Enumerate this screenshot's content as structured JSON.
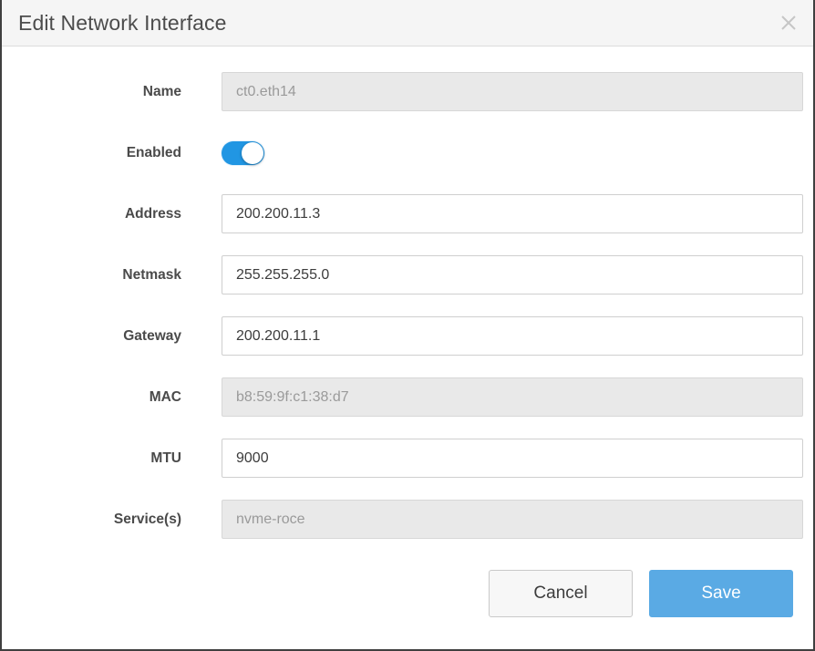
{
  "dialog": {
    "title": "Edit Network Interface",
    "close_icon": "close-icon"
  },
  "form": {
    "rows": [
      {
        "label": "Name",
        "value": "ct0.eth14",
        "readonly": true
      },
      {
        "label": "Enabled",
        "value": "on",
        "readonly": false
      },
      {
        "label": "Address",
        "value": "200.200.11.3",
        "readonly": false
      },
      {
        "label": "Netmask",
        "value": "255.255.255.0",
        "readonly": false
      },
      {
        "label": "Gateway",
        "value": "200.200.11.1",
        "readonly": false
      },
      {
        "label": "MAC",
        "value": "b8:59:9f:c1:38:d7",
        "readonly": true
      },
      {
        "label": "MTU",
        "value": "9000",
        "readonly": false
      },
      {
        "label": "Service(s)",
        "value": "nvme-roce",
        "readonly": true
      }
    ]
  },
  "footer": {
    "cancel_label": "Cancel",
    "save_label": "Save"
  },
  "colors": {
    "accent": "#5aaae4",
    "toggle_on": "#2196e3",
    "header_bg": "#f5f5f5",
    "readonly_bg": "#e9e9e9"
  }
}
